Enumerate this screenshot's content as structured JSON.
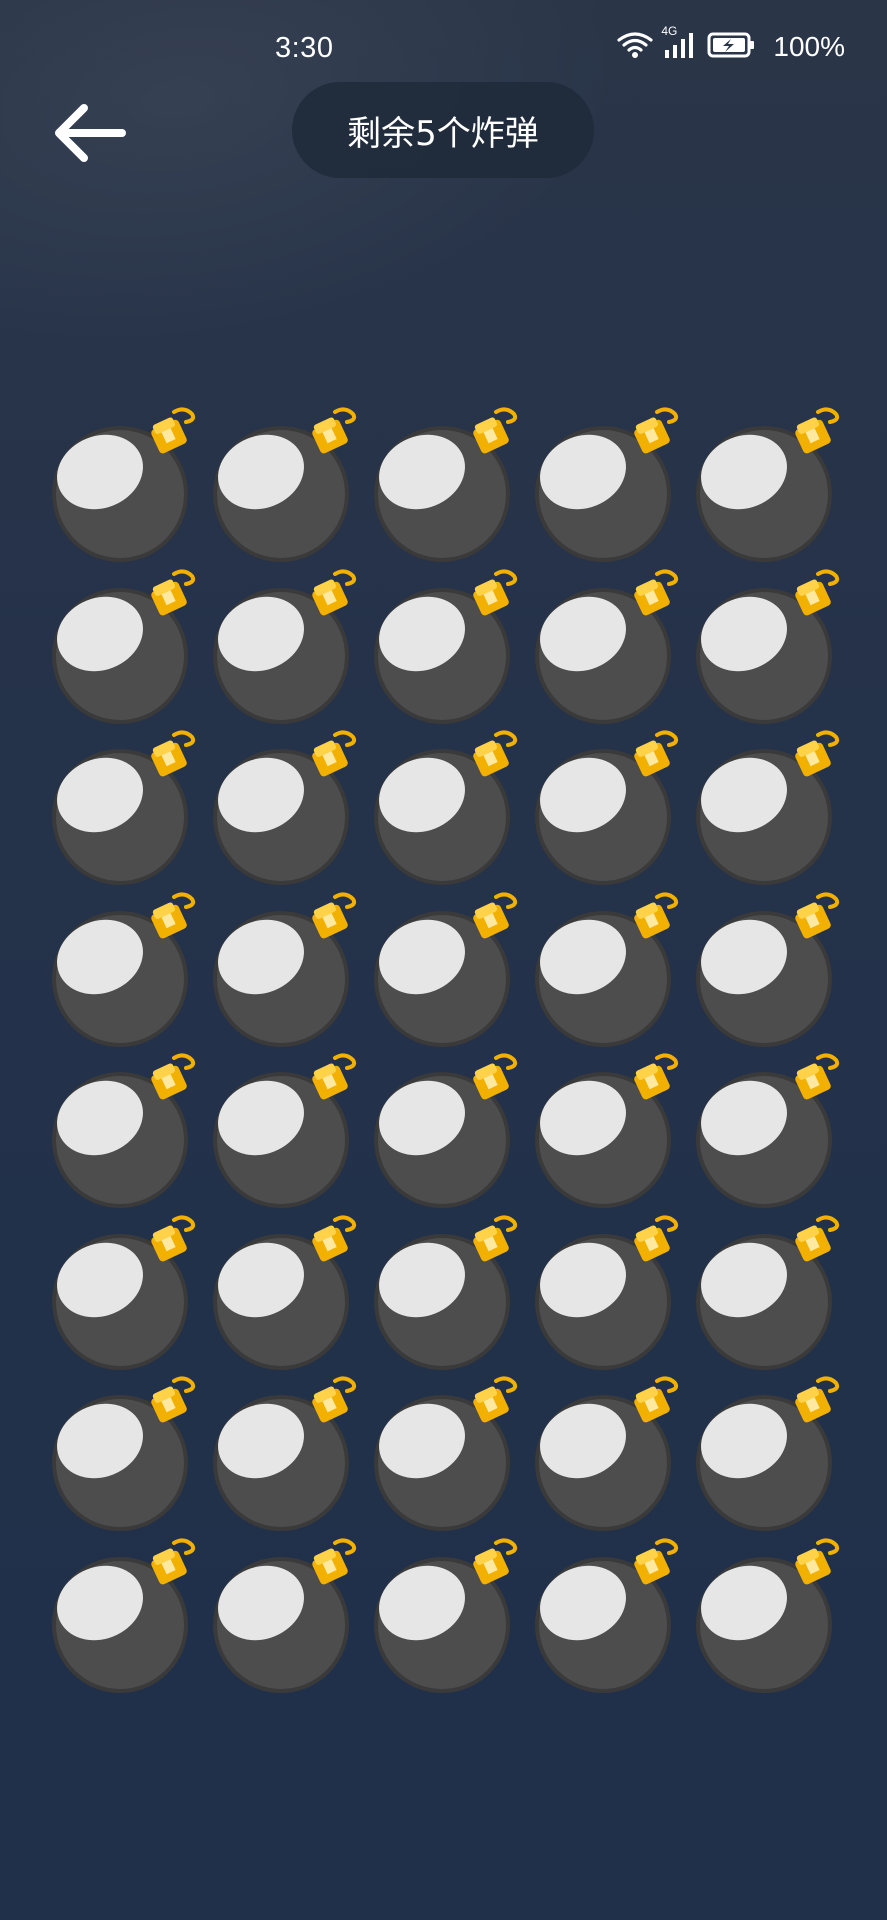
{
  "status_bar": {
    "time": "3:30",
    "network": "4G",
    "battery": "100%",
    "icons": [
      "wifi-icon",
      "cellular-signal-icon",
      "battery-charging-icon"
    ]
  },
  "header": {
    "back_icon": "arrow-left-icon",
    "title": "剩余5个炸弹"
  },
  "grid": {
    "rows": 8,
    "columns": 5,
    "cell_icon": "bomb-icon",
    "colors": {
      "bomb_body": "#4a4a4a",
      "bomb_outline": "#3a3a3a",
      "bomb_highlight": "#e8e8e8",
      "fuse_cap": "#f5b800",
      "background": "#24324a"
    }
  }
}
